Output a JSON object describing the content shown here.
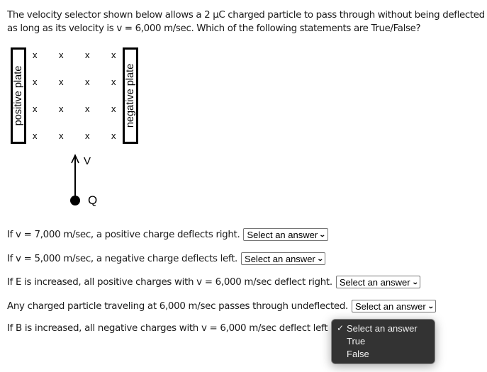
{
  "question": {
    "line1": "The velocity selector shown below allows a 2 μC charged particle to pass through without being deflected",
    "line2": "as long as its velocity is v = 6,000 m/sec. Which of the following statements are True/False?"
  },
  "diagram": {
    "left_plate_label": "positive plate",
    "right_plate_label": "negative plate",
    "field_symbol": "x",
    "field_rows": 4,
    "field_cols": 4,
    "velocity_label": "V",
    "charge_label": "Q"
  },
  "statements": [
    {
      "text": "If v = 7,000 m/sec, a positive charge deflects right.",
      "selected": "Select an answer"
    },
    {
      "text": "If v = 5,000 m/sec, a negative charge deflects left.",
      "selected": "Select an answer"
    },
    {
      "text": "If E is increased, all positive charges with v = 6,000 m/sec deflect right.",
      "selected": "Select an answer"
    },
    {
      "text": "Any charged particle traveling at 6,000 m/sec passes through undeflected.",
      "selected": "Select an answer"
    },
    {
      "text": "If B is increased, all negative charges with v = 6,000 m/sec deflect left",
      "selected": "Select an answer"
    }
  ],
  "dropdown_popup": {
    "options": [
      "Select an answer",
      "True",
      "False"
    ],
    "checked_index": 0,
    "check_glyph": "✓"
  },
  "chevron_glyph": "❯"
}
